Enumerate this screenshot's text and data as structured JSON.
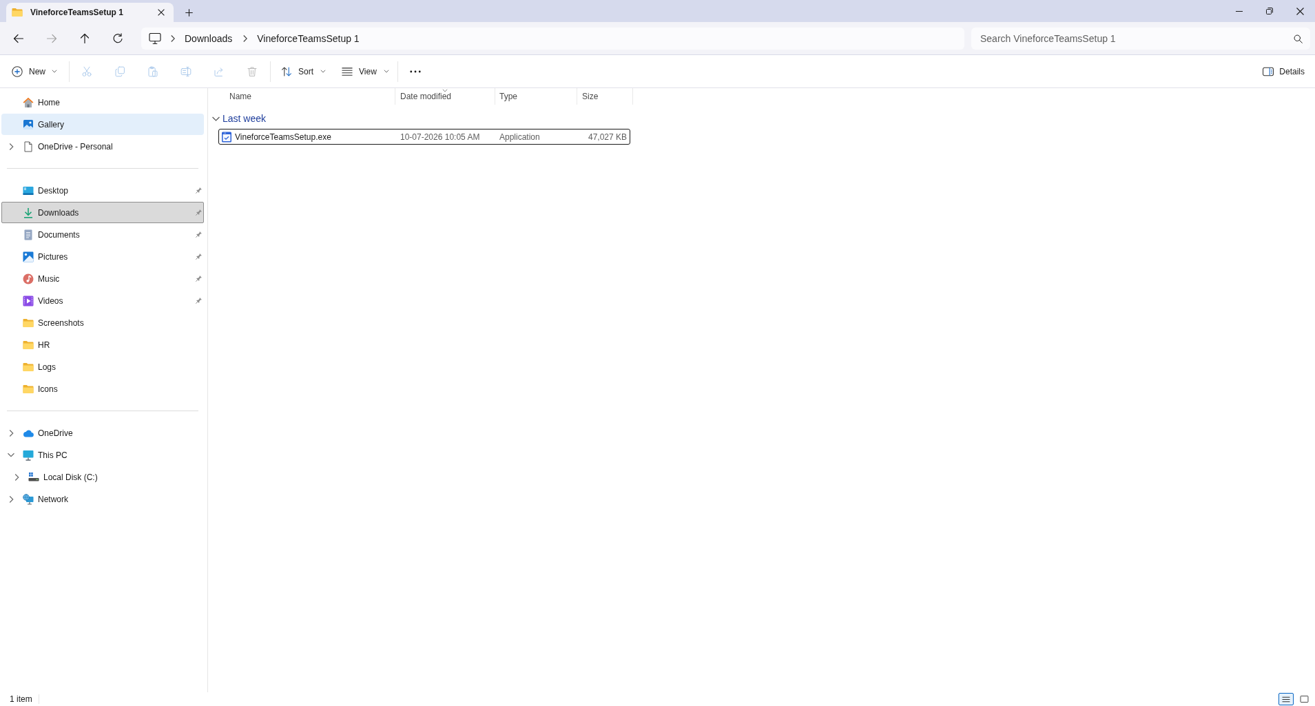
{
  "tabs": [
    {
      "label": "VineforceTeamsSetup 1",
      "selected": true
    }
  ],
  "nav_buttons": [
    {
      "disabled": false
    },
    {
      "disabled": true
    },
    {
      "disabled": false
    },
    {
      "disabled": false
    }
  ],
  "address_bar": {
    "breadcrumbs": [
      "Downloads",
      "VineforceTeamsSetup 1"
    ]
  },
  "search": {
    "placeholder": "Search VineforceTeamsSetup 1"
  },
  "toolbar": {
    "new": {
      "label": "New"
    },
    "actions": [
      {
        "disabled": true
      },
      {
        "disabled": true
      },
      {
        "disabled": true
      },
      {
        "disabled": true
      },
      {
        "disabled": true
      },
      {
        "disabled": true
      }
    ],
    "sort": {
      "label": "Sort"
    },
    "view": {
      "label": "View"
    },
    "details": {
      "label": "Details"
    }
  },
  "sidebar": {
    "sections": [
      {
        "items": [
          {
            "label": "Home",
            "kind": "home",
            "selected": false,
            "hovered": false
          },
          {
            "label": "Gallery",
            "kind": "gallery",
            "selected": false,
            "hovered": true
          },
          {
            "label": "OneDrive - Personal",
            "kind": "account",
            "selected": false,
            "hovered": false,
            "expanded": false
          }
        ]
      },
      {
        "items": [
          {
            "label": "Desktop",
            "kind": "desktop",
            "selected": false,
            "hovered": false,
            "pinned": true
          },
          {
            "label": "Downloads",
            "kind": "downloads",
            "selected": true,
            "hovered": false,
            "pinned": true
          },
          {
            "label": "Documents",
            "kind": "documents",
            "selected": false,
            "hovered": false,
            "pinned": true
          },
          {
            "label": "Pictures",
            "kind": "pictures",
            "selected": false,
            "hovered": false,
            "pinned": true
          },
          {
            "label": "Music",
            "kind": "music",
            "selected": false,
            "hovered": false,
            "pinned": true
          },
          {
            "label": "Videos",
            "kind": "videos",
            "selected": false,
            "hovered": false,
            "pinned": true
          },
          {
            "label": "Screenshots",
            "kind": "folder",
            "selected": false,
            "hovered": false,
            "pinned": false
          },
          {
            "label": "HR",
            "kind": "folder",
            "selected": false,
            "hovered": false,
            "pinned": false
          },
          {
            "label": "Logs",
            "kind": "folder",
            "selected": false,
            "hovered": false,
            "pinned": false
          },
          {
            "label": "Icons",
            "kind": "folder",
            "selected": false,
            "hovered": false,
            "pinned": false
          }
        ]
      },
      {
        "items": [
          {
            "label": "OneDrive",
            "kind": "cloud",
            "selected": false,
            "hovered": false,
            "expanded": false
          },
          {
            "label": "This PC",
            "kind": "computer",
            "selected": false,
            "hovered": false,
            "expanded": true,
            "children": [
              {
                "label": "Local Disk (C:)",
                "kind": "drive",
                "selected": false,
                "hovered": false,
                "expanded": false
              }
            ]
          },
          {
            "label": "Network",
            "kind": "network",
            "selected": false,
            "hovered": false,
            "expanded": false
          }
        ]
      }
    ]
  },
  "file_list": {
    "columns": [
      {
        "label": "Name",
        "sorted": false
      },
      {
        "label": "Date modified",
        "sorted": true
      },
      {
        "label": "Type",
        "sorted": false
      },
      {
        "label": "Size",
        "sorted": false
      }
    ],
    "groups": [
      {
        "label": "Last week",
        "expanded": true,
        "rows": [
          {
            "name": "VineforceTeamsSetup.exe",
            "date_modified": "10-07-2026 10:05 AM",
            "type": "Application",
            "size": "47,027 KB",
            "focused": true
          }
        ]
      }
    ]
  },
  "status_bar": {
    "item_count": "1 item",
    "view_modes": [
      {
        "selected": true
      },
      {
        "selected": false
      }
    ]
  }
}
